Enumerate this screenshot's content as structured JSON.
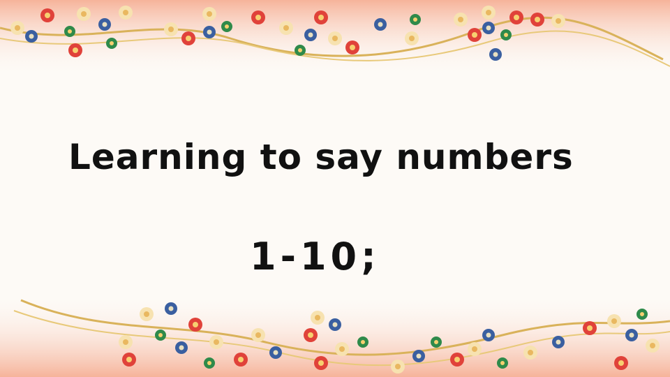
{
  "slide": {
    "title": "Learning to say numbers",
    "subtitle": "1-10;"
  },
  "colors": {
    "background": "#fdfaf6",
    "border_gradient": "#f6b39a",
    "flower_red": "#e0423a",
    "flower_blue": "#3a5fa0",
    "flower_green": "#2f8a4a",
    "flower_cream": "#f7e2b0",
    "gold_ribbon": "#d9b25a"
  }
}
